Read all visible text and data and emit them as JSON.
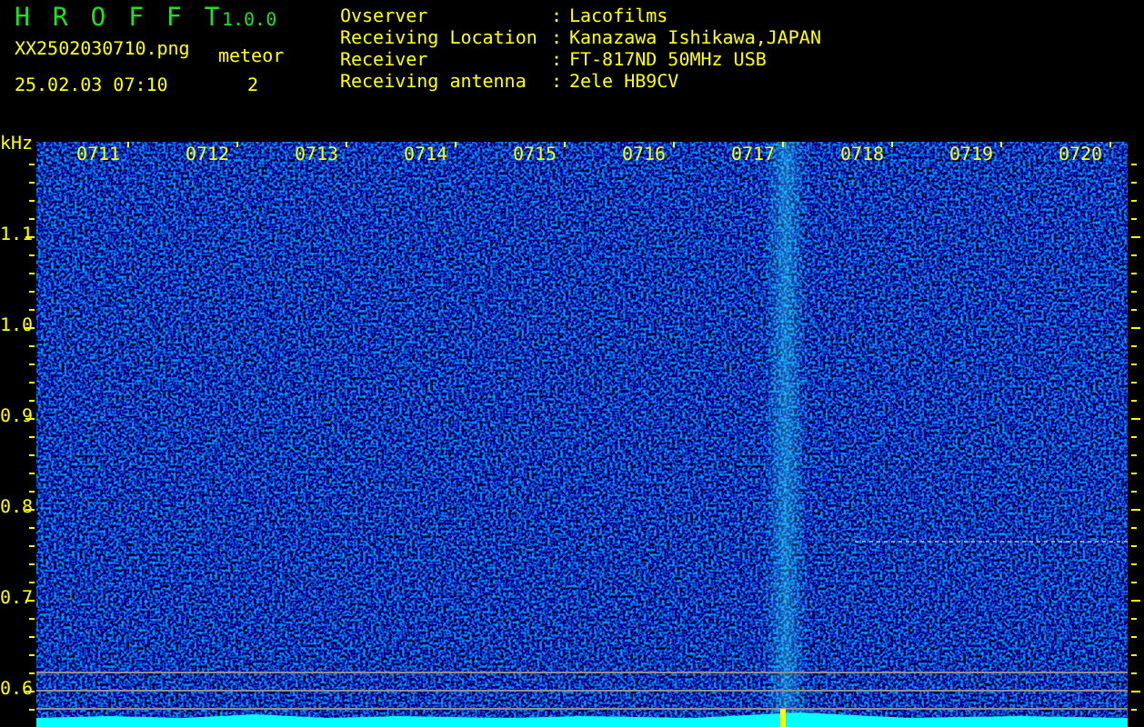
{
  "header": {
    "app_title": "H R O F F T",
    "version": "1.0.0",
    "filename": "XX2502030710.png",
    "datetime": "25.02.03 07:10",
    "meteor_label": "meteor",
    "meteor_count": "2",
    "info": [
      {
        "label": "Ovserver",
        "separator": ":",
        "value": "Lacofilms"
      },
      {
        "label": "Receiving Location",
        "separator": ":",
        "value": "Kanazawa Ishikawa,JAPAN"
      },
      {
        "label": "Receiver",
        "separator": ":",
        "value": "FT-817ND 50MHz USB"
      },
      {
        "label": "Receiving antenna",
        "separator": ":",
        "value": "2ele HB9CV"
      }
    ]
  },
  "spectrogram": {
    "unit": "kHz",
    "time_labels": [
      "0711",
      "0712",
      "0713",
      "0714",
      "0715",
      "0716",
      "0717",
      "0718",
      "0719",
      "0720"
    ],
    "freq_labels": [
      "1.1",
      "1.0",
      "0.9",
      "0.8",
      "0.7",
      "0.6"
    ]
  }
}
